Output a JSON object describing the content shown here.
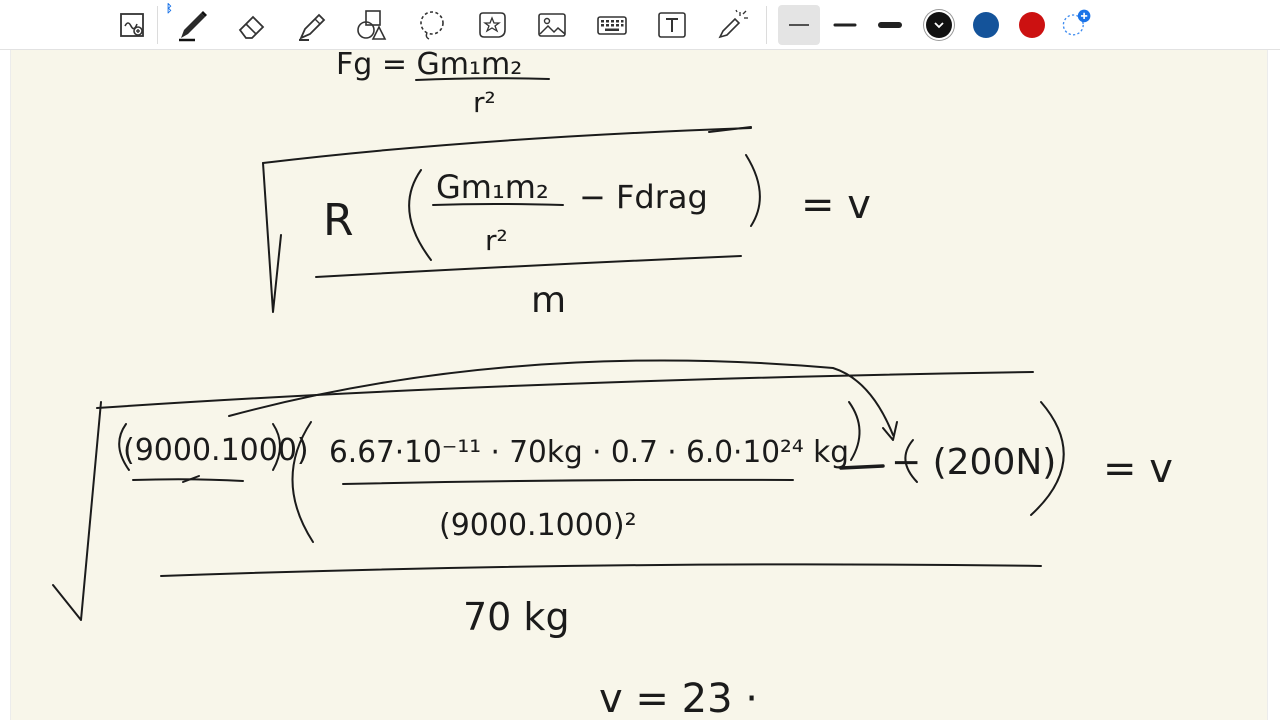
{
  "toolbar": {
    "tools": [
      {
        "name": "zoom-window-icon"
      },
      {
        "name": "pen-icon",
        "selected": true
      },
      {
        "name": "eraser-icon"
      },
      {
        "name": "highlighter-icon"
      },
      {
        "name": "shapes-icon"
      },
      {
        "name": "lasso-icon"
      },
      {
        "name": "stickers-icon"
      },
      {
        "name": "image-icon"
      },
      {
        "name": "keyboard-icon"
      },
      {
        "name": "text-icon"
      },
      {
        "name": "laser-pointer-icon"
      }
    ],
    "stroke_widths": [
      "thin",
      "medium",
      "thick"
    ],
    "selected_width": "thin",
    "colors": [
      "#111111",
      "#14539a",
      "#cc1111"
    ],
    "selected_color": "#111111"
  },
  "note": {
    "line1_fg": "Fg = Gm₁m₂",
    "line1_den": "r²",
    "formula_R": "R",
    "formula_num": "Gm₁m₂",
    "formula_den": "r²",
    "formula_drag": "− Fdrag",
    "formula_m": "m",
    "formula_eq": "= v",
    "sub_radius": "(9000.1000)",
    "sub_num": "6.67·10⁻¹¹ · 70kg · 0.7 · 6.0·10²⁴ kg",
    "sub_den": "(9000.1000)²",
    "sub_drag": "− (200N)",
    "sub_eq": "= v",
    "sub_mass": "70 kg",
    "result": "v = 23 ·"
  }
}
